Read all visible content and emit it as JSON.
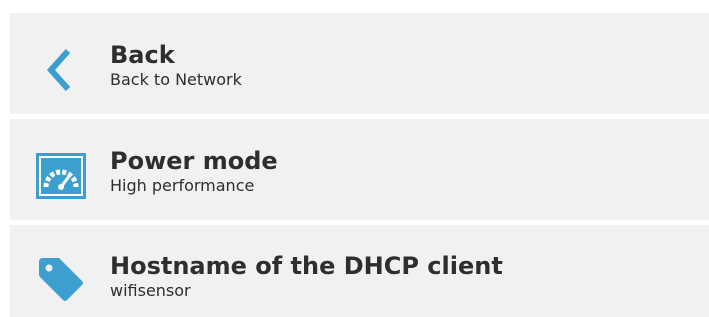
{
  "accent_color": "#3d9fd0",
  "menu": {
    "items": [
      {
        "icon": "chevron-left-icon",
        "title": "Back",
        "subtitle": "Back to Network"
      },
      {
        "icon": "gauge-icon",
        "title": "Power mode",
        "subtitle": "High performance"
      },
      {
        "icon": "tag-icon",
        "title": "Hostname of the DHCP client",
        "subtitle": "wifisensor"
      }
    ]
  }
}
